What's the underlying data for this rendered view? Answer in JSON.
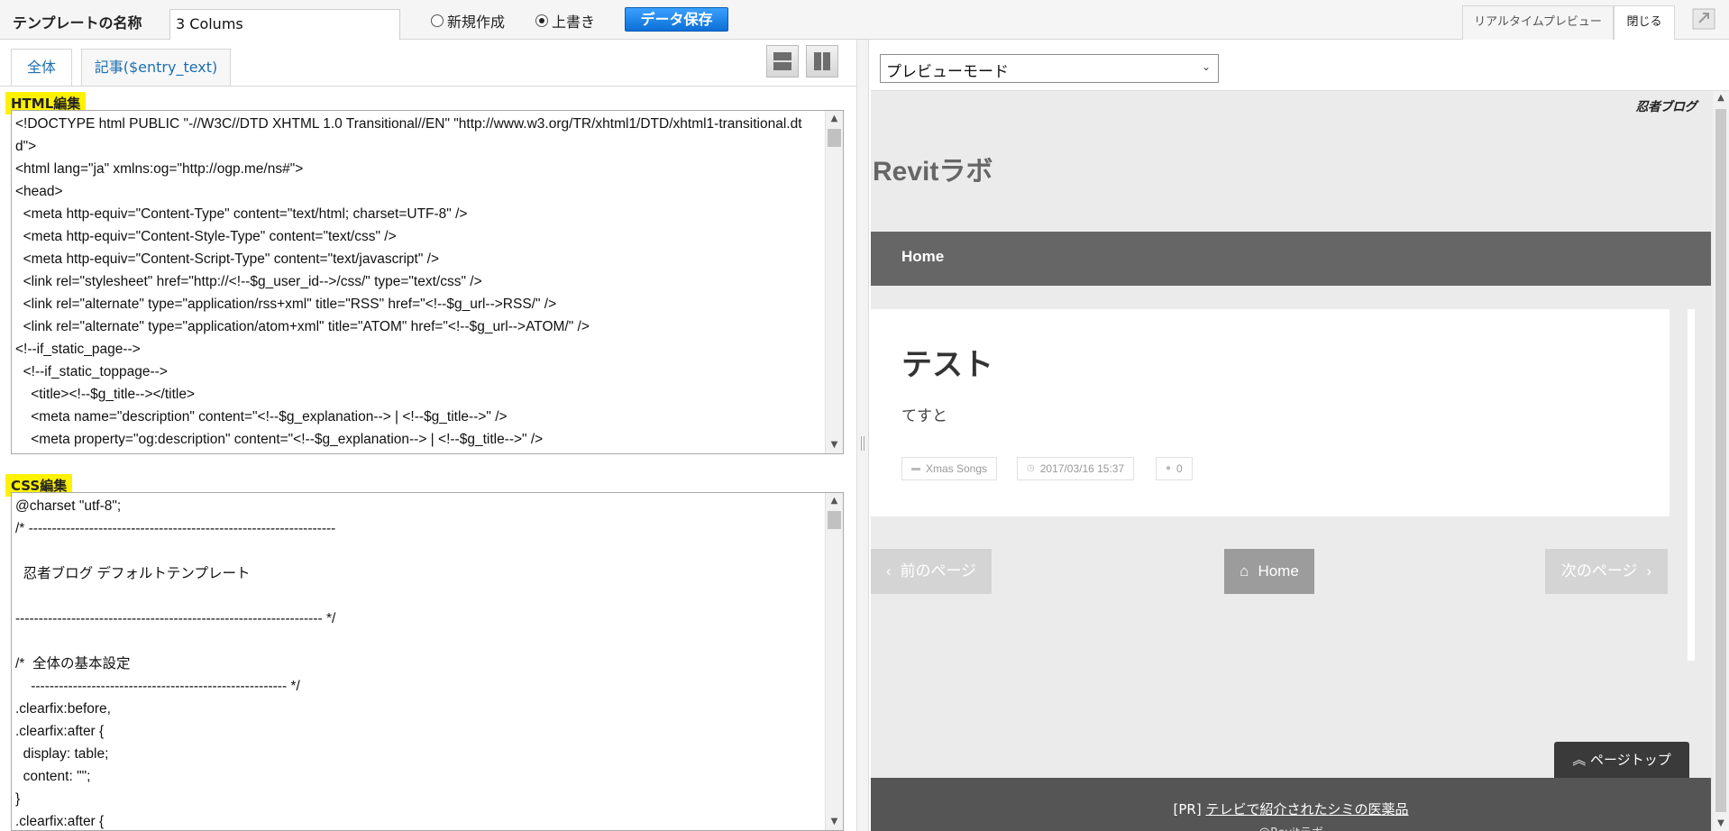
{
  "toolbar": {
    "template_name_label": "テンプレートの名称",
    "template_name_value": "3 Colums",
    "radio_new": "新規作成",
    "radio_overwrite": "上書き",
    "save_button": "データ保存",
    "tab_realtime_preview": "リアルタイムプレビュー",
    "tab_close": "閉じる"
  },
  "editor": {
    "tabs": [
      {
        "label": "全体"
      },
      {
        "label": "記事($entry_text)"
      }
    ],
    "html_label": "HTML編集",
    "css_label": "CSS編集",
    "html_code": "<!DOCTYPE html PUBLIC \"-//W3C//DTD XHTML 1.0 Transitional//EN\" \"http://www.w3.org/TR/xhtml1/DTD/xhtml1-transitional.dtd\">\n<html lang=\"ja\" xmlns:og=\"http://ogp.me/ns#\">\n<head>\n  <meta http-equiv=\"Content-Type\" content=\"text/html; charset=UTF-8\" />\n  <meta http-equiv=\"Content-Style-Type\" content=\"text/css\" />\n  <meta http-equiv=\"Content-Script-Type\" content=\"text/javascript\" />\n  <link rel=\"stylesheet\" href=\"http://<!--$g_user_id-->/css/\" type=\"text/css\" />\n  <link rel=\"alternate\" type=\"application/rss+xml\" title=\"RSS\" href=\"<!--$g_url-->RSS/\" />\n  <link rel=\"alternate\" type=\"application/atom+xml\" title=\"ATOM\" href=\"<!--$g_url-->ATOM/\" />\n<!--if_static_page-->\n  <!--if_static_toppage-->\n    <title><!--$g_title--></title>\n    <meta name=\"description\" content=\"<!--$g_explanation--> | <!--$g_title-->\" />\n    <meta property=\"og:description\" content=\"<!--$g_explanation--> | <!--$g_title-->\" />",
    "css_code": "@charset \"utf-8\";\n/* ------------------------------------------------------------------\n\n  忍者ブログ デフォルトテンプレート\n\n------------------------------------------------------------------ */\n\n/*  全体の基本設定\n    ------------------------------------------------------- */\n.clearfix:before,\n.clearfix:after {\n  display: table;\n  content: \"\";\n}\n.clearfix:after {"
  },
  "preview": {
    "mode_select": "プレビューモード",
    "ninja_logo": "忍者ブログ",
    "blog_title": "Revitラボ",
    "nav_home": "Home",
    "article": {
      "title": "テスト",
      "body": "てすと",
      "category": "Xmas Songs",
      "date": "2017/03/16 15:37",
      "comments": "0"
    },
    "pager": {
      "prev": "前のページ",
      "home": "Home",
      "next": "次のページ"
    },
    "page_top": "ページトップ",
    "footer_pr_prefix": "[PR] ",
    "footer_pr_link": "テレビで紹介されたシミの医薬品",
    "footer_copy": "@Revitラボ"
  }
}
